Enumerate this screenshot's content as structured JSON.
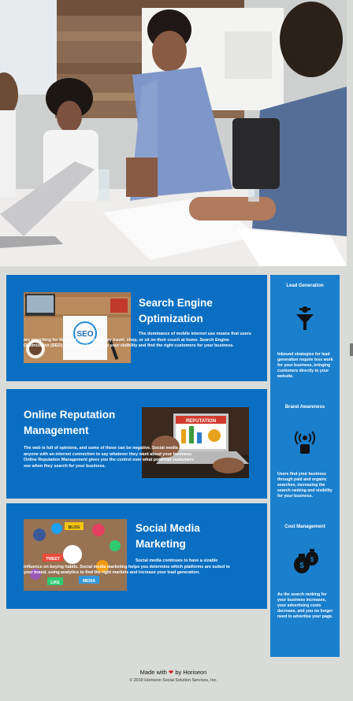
{
  "hero": {
    "alt": "Business team meeting around a table with laptops and papers"
  },
  "services": [
    {
      "title_line1": "Search Engine",
      "title_line2": "Optimization",
      "body": "The dominance of mobile internet use means that users are searching for the right business as they travel, shop, or sit on their couch at home. Search Engine Optimization (SEO) allows you to increase your visibility and find the right customers for your business.",
      "thumb_word": "SEO"
    },
    {
      "title_line1": "Online Reputation",
      "title_line2": "Management",
      "body": "The web is full of opinions, and some of these can be negative. Social media allows anyone with an internet connection to say whatever they want about your business. Online Reputation Management gives you the control over what potential customers see when they search for your business.",
      "thumb_word": "REPUTATION"
    },
    {
      "title_line1": "Social Media",
      "title_line2": "Marketing",
      "body": "Social media continues to have a sizable influence on buying habits. Social media marketing helps you determine which platforms are suited to your brand, using analytics to find the right markets and increase your lead generation.",
      "thumb_words": [
        "BLOG",
        "TWEET",
        "MEDIA",
        "LIKE"
      ]
    }
  ],
  "benefits": [
    {
      "title": "Lead Generation",
      "icon": "lead-funnel-icon",
      "text": "Inbound strategies for lead generation require less work for your business, bringing customers directly to your website."
    },
    {
      "title": "Brand Awareness",
      "icon": "broadcast-person-icon",
      "text": "Users find your business through paid and organic searches, increasing the search ranking and visibility for your business."
    },
    {
      "title": "Cost Management",
      "icon": "money-bags-icon",
      "text": "As the search ranking for your business increases, your advertising costs decrease, and you no longer need to advertise your page."
    }
  ],
  "footer": {
    "made_with": "Made with",
    "by": "by Horiseon",
    "copyright": "© 2019 Horiseon Social Solution Services, Inc."
  },
  "colors": {
    "card_blue": "#0a6fc2",
    "sidebar_blue": "#1a7fcc",
    "page_bg": "#d9dbd8",
    "heart": "#d0171f"
  }
}
